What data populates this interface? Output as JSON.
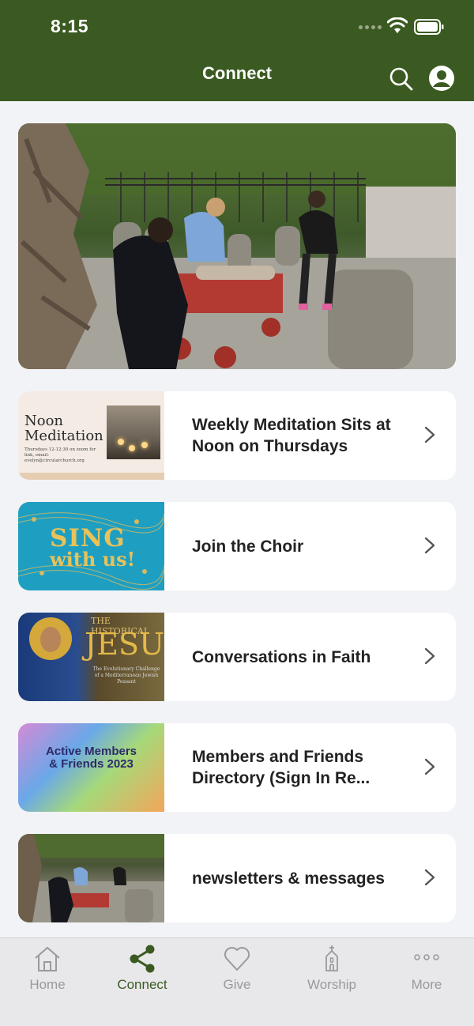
{
  "status_bar": {
    "time": "8:15"
  },
  "header": {
    "title": "Connect"
  },
  "items": [
    {
      "label": "Weekly Meditation Sits at Noon on Thursdays",
      "thumb_title": "Noon Meditation",
      "thumb_sub": "Thursdays 12-12:30 on zoom for link, email: evelyn@circularchurch.org"
    },
    {
      "label": "Join the Choir",
      "thumb_line1": "SING",
      "thumb_line2": "with us!"
    },
    {
      "label": "Conversations in Faith",
      "thumb_kicker": "THE HISTORICAL",
      "thumb_title": "JESUS",
      "thumb_sub": "The Evolutionary Challenge of a Mediterranean Jewish Peasant"
    },
    {
      "label": "Members and Friends Directory (Sign In Re...",
      "thumb_title": "Active Members & Friends 2023"
    },
    {
      "label": "newsletters & messages"
    }
  ],
  "tabs": [
    {
      "label": "Home",
      "icon": "home-icon"
    },
    {
      "label": "Connect",
      "icon": "share-icon"
    },
    {
      "label": "Give",
      "icon": "heart-icon"
    },
    {
      "label": "Worship",
      "icon": "church-icon"
    },
    {
      "label": "More",
      "icon": "more-icon"
    }
  ],
  "colors": {
    "header": "#3b5a21",
    "active_tab": "#3b5a21",
    "inactive_tab": "#9a9a9c",
    "background": "#f2f3f7"
  }
}
